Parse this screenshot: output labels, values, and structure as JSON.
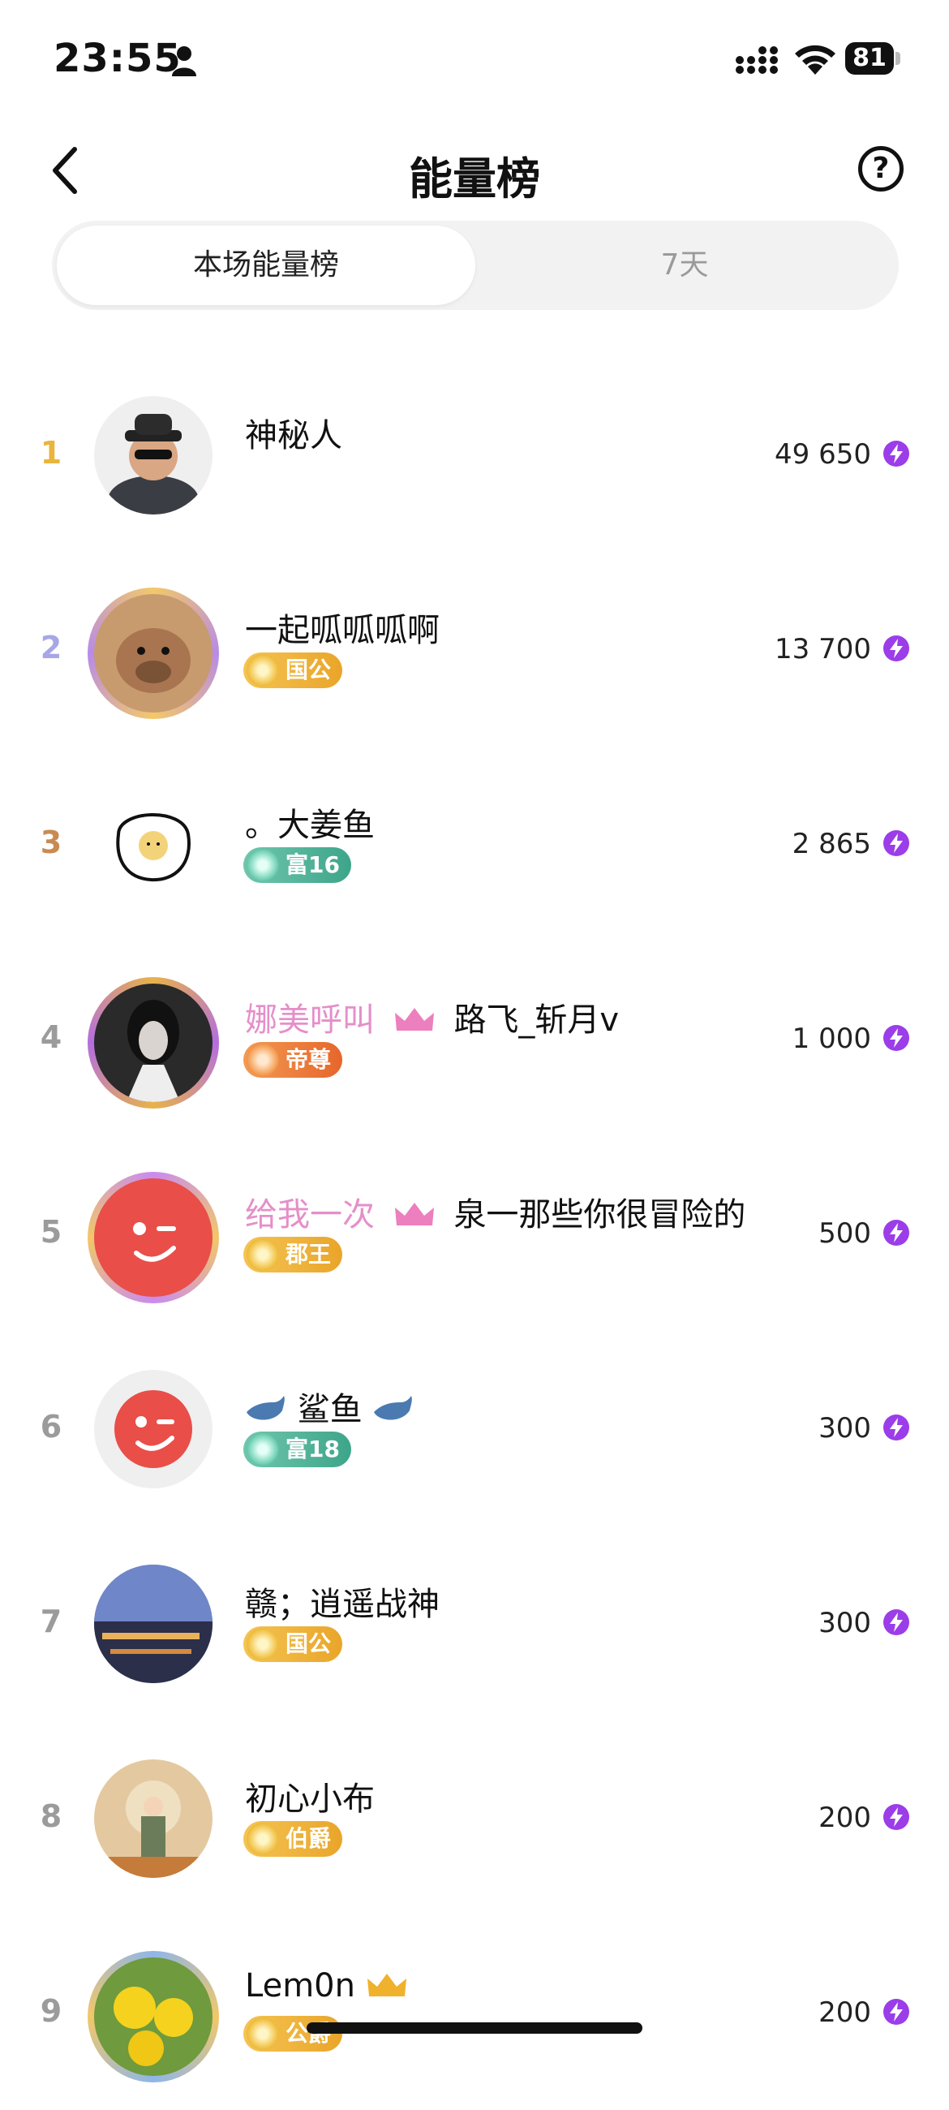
{
  "status_bar": {
    "time": "23:55",
    "battery": "81",
    "icons": [
      "person-icon",
      "signal-icon",
      "wifi-icon",
      "battery-icon"
    ]
  },
  "header": {
    "title": "能量榜",
    "back_icon": "chevron-left-icon",
    "help_label": "?"
  },
  "tabs": [
    {
      "label": "本场能量榜",
      "active": true
    },
    {
      "label": "7天",
      "active": false
    }
  ],
  "rows": [
    {
      "rank": "1",
      "name": "神秘人",
      "score": "49 650"
    },
    {
      "rank": "2",
      "name": "一起呱呱呱啊",
      "badge": "国公",
      "score": "13 700"
    },
    {
      "rank": "3",
      "name": "。大姜鱼",
      "badge": "富16",
      "score": "2 865"
    },
    {
      "rank": "4",
      "name_prefix": "娜美呼叫",
      "name_suffix": "路飞_斩月v",
      "badge": "帝尊",
      "score": "1 000"
    },
    {
      "rank": "5",
      "name_prefix": "给我一次",
      "name_suffix": "泉一那些你很冒险的",
      "badge": "郡王",
      "score": "500"
    },
    {
      "rank": "6",
      "name": "鲨鱼",
      "badge": "富18",
      "score": "300"
    },
    {
      "rank": "7",
      "name": "赣；逍遥战神",
      "badge": "国公",
      "score": "300"
    },
    {
      "rank": "8",
      "name": "初心小布",
      "badge": "伯爵",
      "score": "200"
    },
    {
      "rank": "9",
      "name": "Lem0n",
      "badge": "公爵",
      "score": "200"
    }
  ],
  "colors": {
    "rank_1": "#e9b53c",
    "rank_2": "#a7a6e6",
    "rank_3": "#c98a52",
    "rank_other": "#9b9b9b",
    "energy_icon": "#9b3de8"
  }
}
